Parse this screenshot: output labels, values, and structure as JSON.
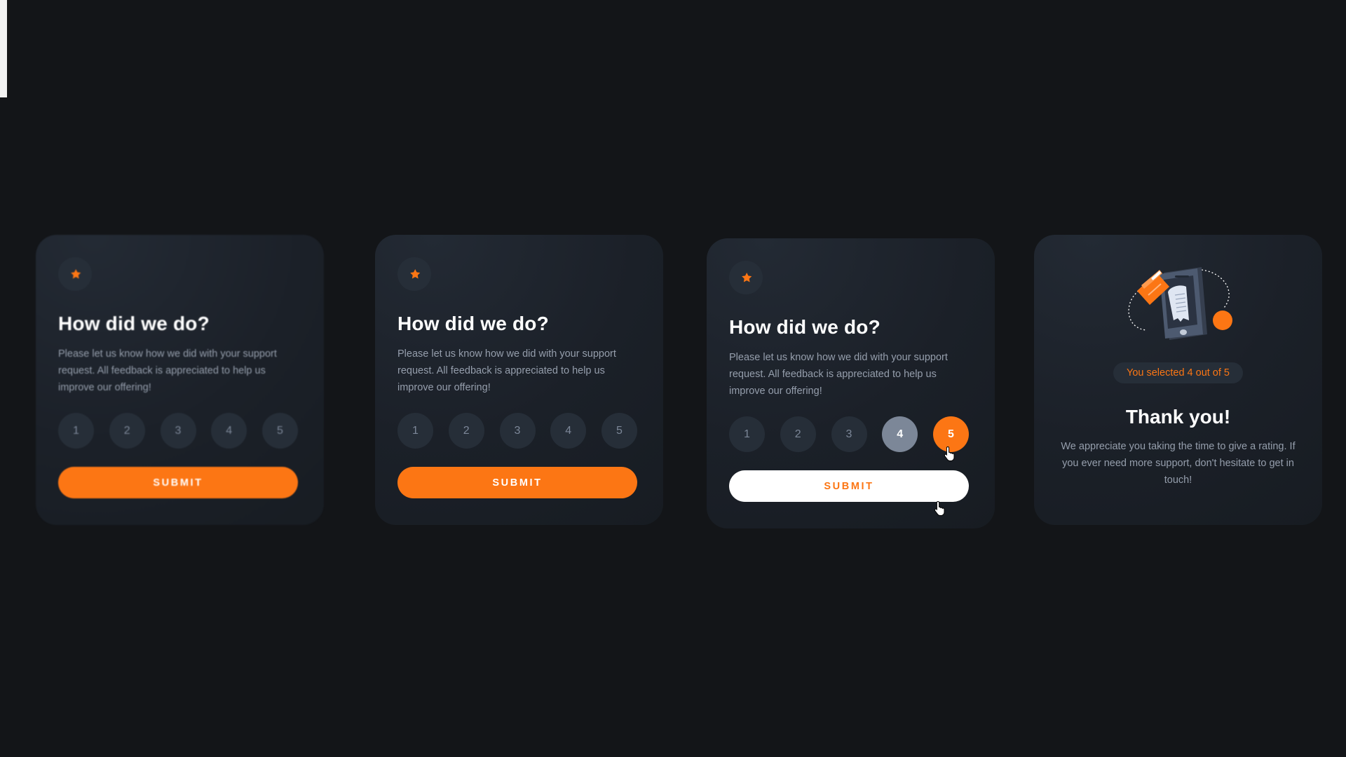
{
  "colors": {
    "background": "#131518",
    "card": "#1f2630",
    "orange": "#fc7614",
    "muted": "#959eac",
    "circle": "#262e38",
    "hover_grey": "#7c8798"
  },
  "rating_card": {
    "title": "How did we do?",
    "description": "Please let us know how we did with your support request. All feedback is appreciated to help us improve our offering!",
    "options": [
      "1",
      "2",
      "3",
      "4",
      "5"
    ],
    "submit_label": "SUBMIT",
    "star_icon": "star-icon"
  },
  "states": {
    "card3_hovered_rating": "4",
    "card3_selected_rating": "5"
  },
  "thank_you_card": {
    "selected_text": "You selected 4 out of 5",
    "title": "Thank you!",
    "description": "We appreciate you taking the time to give a rating. If you ever need more support, don't hesitate to get in touch!",
    "illustration_icon": "phone-payment-illustration"
  }
}
